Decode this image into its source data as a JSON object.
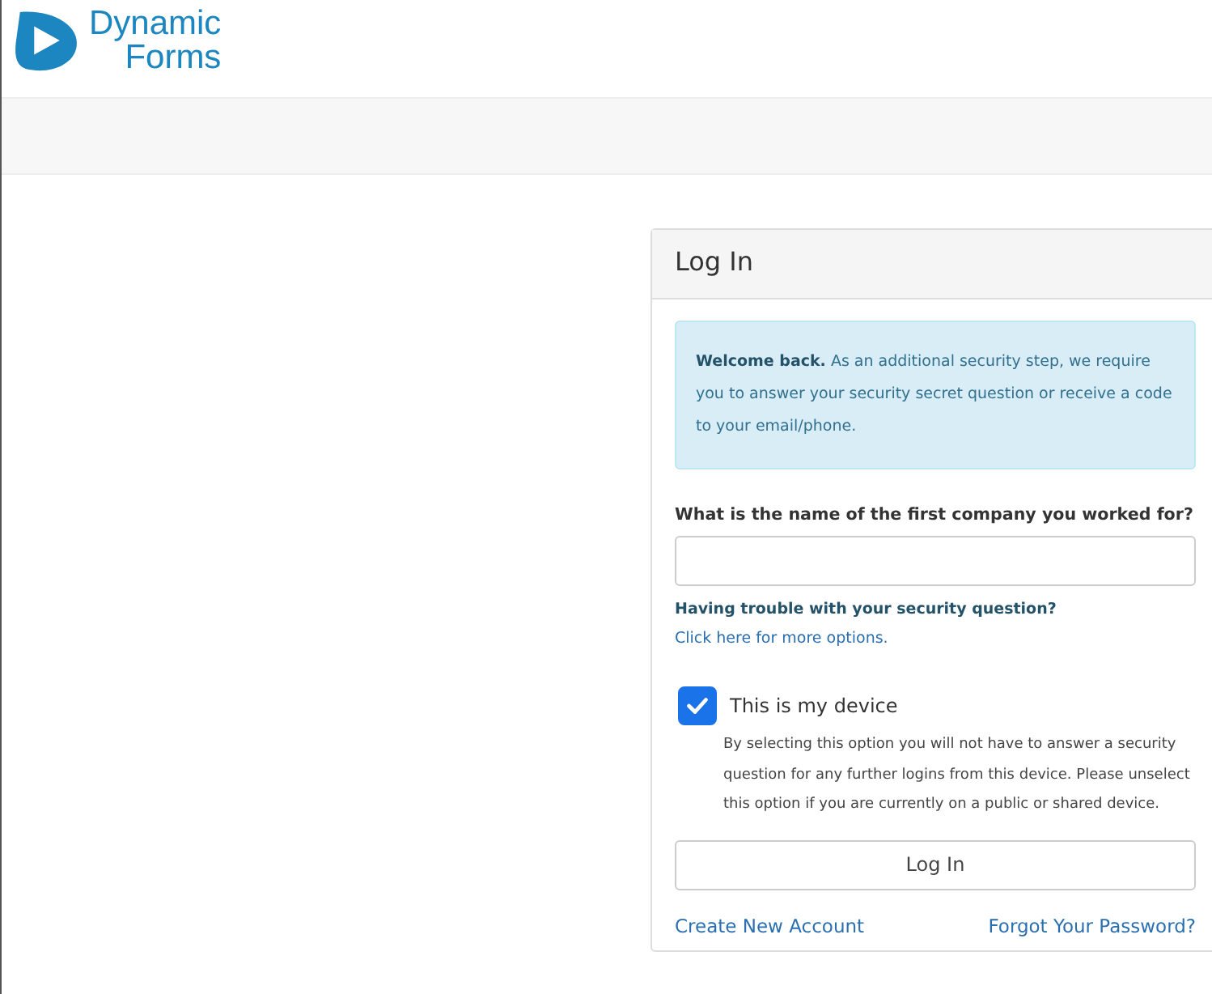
{
  "logo": {
    "line1": "Dynamic",
    "line2": "Forms"
  },
  "panel": {
    "title": "Log In",
    "alert": "**Welcome back.** As an additional security step, we require you to answer your security secret question or receive a code to your email/phone.",
    "question": {
      "label": "What is the name of the first company you worked for?"
    },
    "help": {
      "text": "Having trouble with your security question?",
      "link": "Click here for more options."
    },
    "device": {
      "label": "This is my device",
      "checked": true,
      "note": "By selecting this option you will not have to answer a security question for any further logins from this device. Please unselect this option if you are currently on a public or shared device."
    },
    "button": "Log In",
    "links": [
      "Create New Account",
      "Forgot Your Password?"
    ]
  }
}
